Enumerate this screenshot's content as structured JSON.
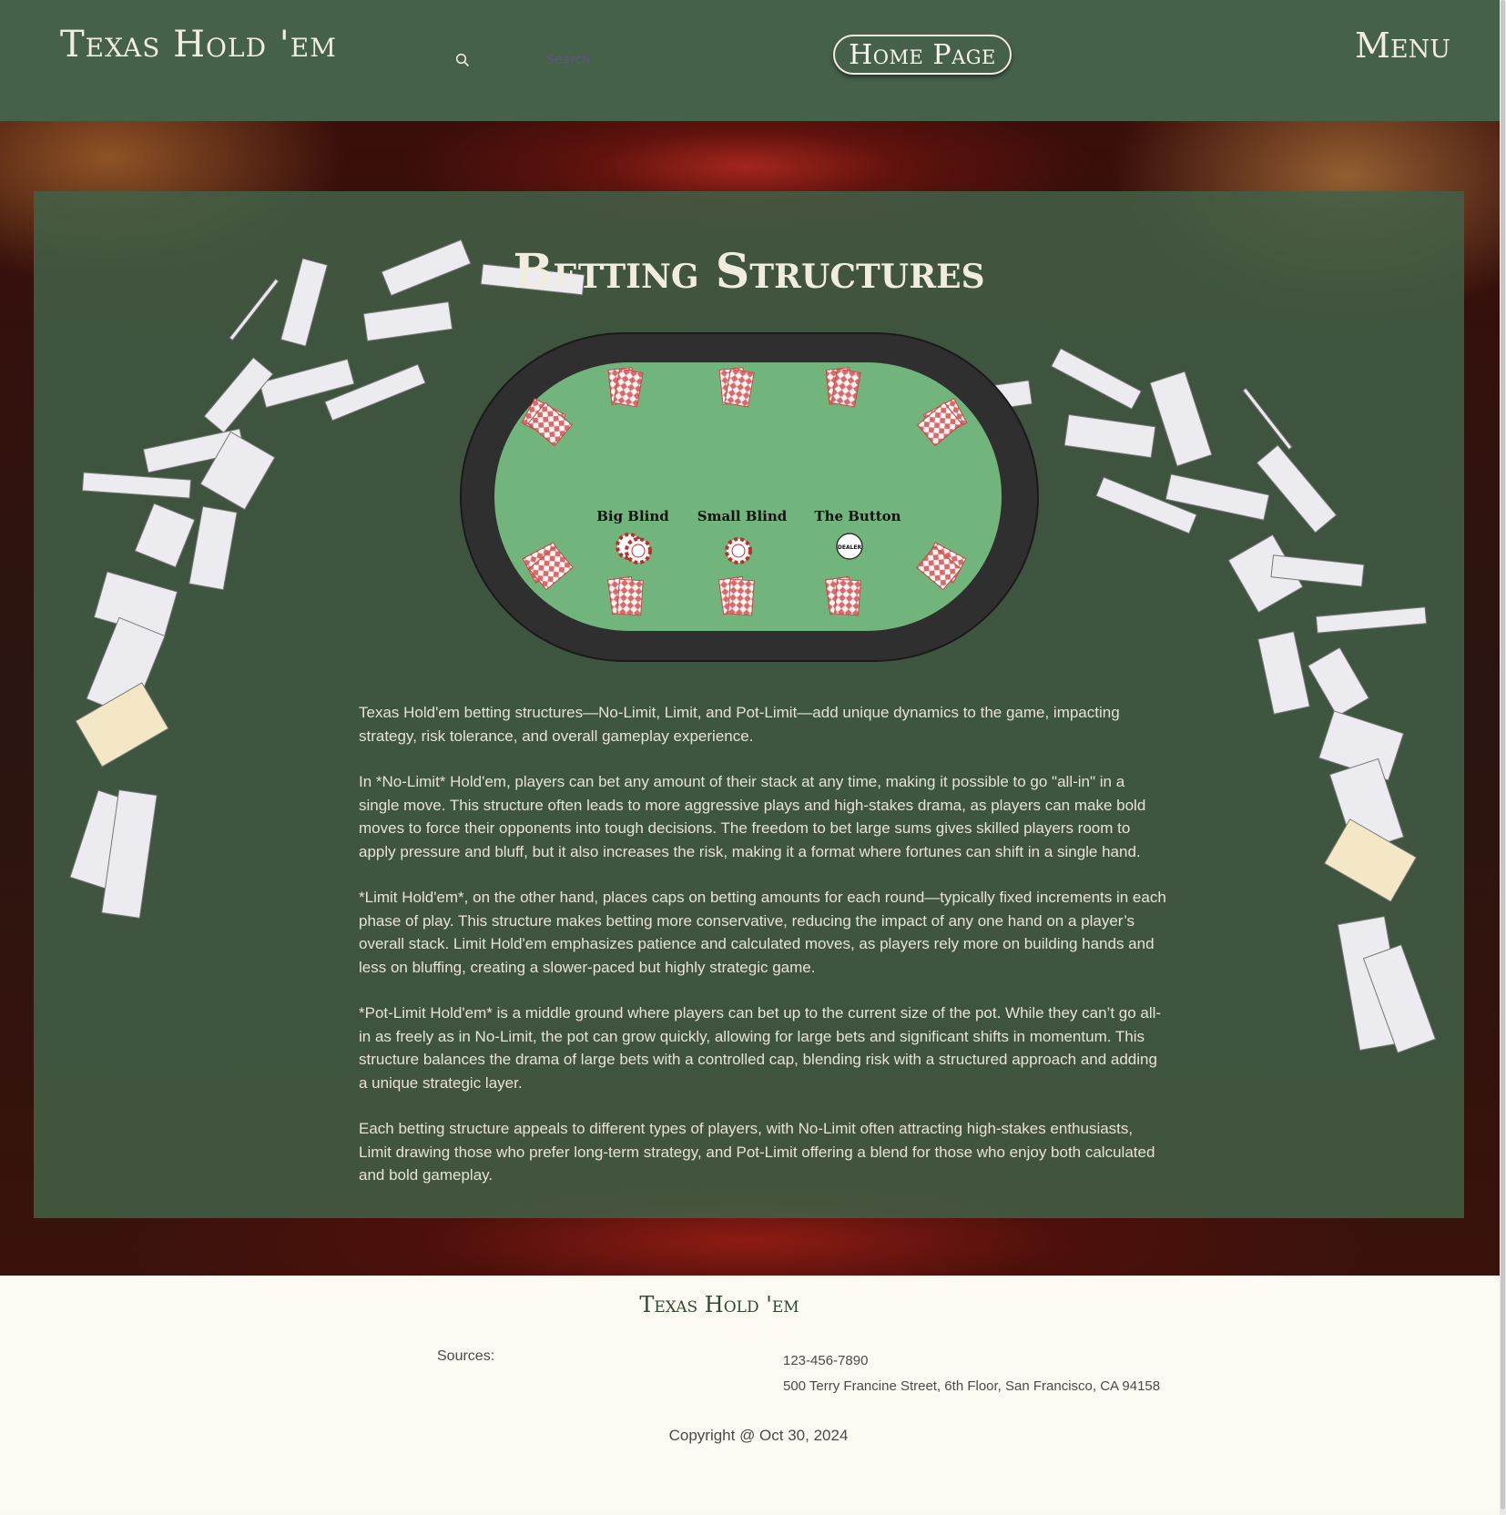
{
  "header": {
    "logo": "Texas Hold 'em",
    "search_placeholder": "Search",
    "home_label": "Home Page",
    "menu_label": "Menu"
  },
  "main": {
    "title": "Betting Structures",
    "table_labels": {
      "big_blind": "Big Blind",
      "small_blind": "Small Blind",
      "button": "The Button",
      "dealer_chip": "DEALER"
    },
    "paragraphs": [
      "Texas Hold'em betting structures—No-Limit, Limit, and Pot-Limit—add unique dynamics to the game, impacting strategy, risk tolerance, and overall gameplay experience.",
      "In *No-Limit* Hold'em, players can bet any amount of their stack at any time, making it possible to go \"all-in\" in a single move. This structure often leads to more aggressive plays and high-stakes drama, as players can make bold moves to force their opponents into tough decisions. The freedom to bet large sums gives skilled players room to apply pressure and bluff, but it also increases the risk, making it a format where fortunes can shift in a single hand.",
      "*Limit Hold'em*, on the other hand, places caps on betting amounts for each round—typically fixed increments in each phase of play. This structure makes betting more conservative, reducing the impact of any one hand on a player’s overall stack. Limit Hold'em emphasizes patience and calculated moves, as players rely more on building hands and less on bluffing, creating a slower-paced but highly strategic game.",
      "*Pot-Limit Hold'em* is a middle ground where players can bet up to the current size of the pot. While they can’t go all-in as freely as in No-Limit, the pot can grow quickly, allowing for large bets and significant shifts in momentum. This structure balances the drama of large bets with a controlled cap, blending risk with a structured approach and adding a unique strategic layer.",
      "Each betting structure appeals to different types of players, with No-Limit often attracting high-stakes enthusiasts, Limit drawing those who prefer long-term strategy, and Pot-Limit offering a blend for those who enjoy both calculated and bold gameplay."
    ]
  },
  "footer": {
    "title": "Texas Hold 'em",
    "sources_label": "Sources:",
    "phone": "123-456-7890",
    "address": "500 Terry Francine Street, 6th Floor, San Francisco, CA 94158",
    "copyright": "Copyright @ Oct 30, 2024"
  },
  "colors": {
    "header_bg": "#45614a",
    "panel_bg": "#426048",
    "felt": "#72b57c",
    "rail": "#2f2f2f",
    "footer_bg": "#fcfaf2",
    "cream_text": "#f1ece0"
  }
}
